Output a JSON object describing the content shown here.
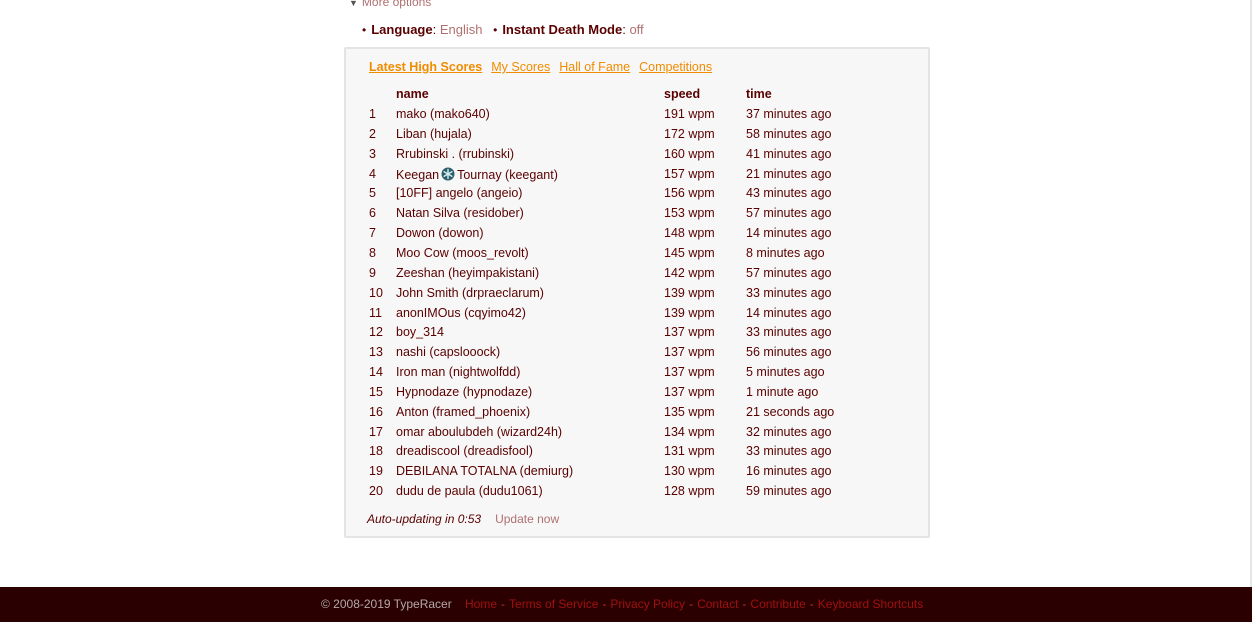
{
  "more_options": {
    "label": "More options"
  },
  "settings": {
    "language_label": "Language",
    "language_value": "English",
    "instant_death_label": "Instant Death Mode",
    "instant_death_value": "off"
  },
  "tabs": [
    {
      "label": "Latest High Scores",
      "active": true
    },
    {
      "label": "My Scores",
      "active": false
    },
    {
      "label": "Hall of Fame",
      "active": false
    },
    {
      "label": "Competitions",
      "active": false
    }
  ],
  "table": {
    "columns": {
      "name": "name",
      "speed": "speed",
      "time": "time"
    },
    "rows": [
      {
        "rank": "1",
        "name": "mako (mako640)",
        "speed": "191 wpm",
        "time": "37 minutes ago"
      },
      {
        "rank": "2",
        "name": "Liban (hujala)",
        "speed": "172 wpm",
        "time": "58 minutes ago"
      },
      {
        "rank": "3",
        "name": "Rrubinski . (rrubinski)",
        "speed": "160 wpm",
        "time": "41 minutes ago"
      },
      {
        "rank": "4",
        "name_before_icon": "Keegan",
        "name_icon": "snowflake-badge-icon",
        "name_after_icon": "Tournay (keegant)",
        "speed": "157 wpm",
        "time": "21 minutes ago"
      },
      {
        "rank": "5",
        "name": "[10FF] angelo (angeio)",
        "speed": "156 wpm",
        "time": "43 minutes ago"
      },
      {
        "rank": "6",
        "name": "Natan Silva (residober)",
        "speed": "153 wpm",
        "time": "57 minutes ago"
      },
      {
        "rank": "7",
        "name": "Dowon (dowon)",
        "speed": "148 wpm",
        "time": "14 minutes ago"
      },
      {
        "rank": "8",
        "name": "Moo Cow (moos_revolt)",
        "speed": "145 wpm",
        "time": "8 minutes ago"
      },
      {
        "rank": "9",
        "name": "Zeeshan (heyimpakistani)",
        "speed": "142 wpm",
        "time": "57 minutes ago"
      },
      {
        "rank": "10",
        "name": "John Smith (drpraeclarum)",
        "speed": "139 wpm",
        "time": "33 minutes ago"
      },
      {
        "rank": "11",
        "name": "anonIMOus (cqyimo42)",
        "speed": "139 wpm",
        "time": "14 minutes ago"
      },
      {
        "rank": "12",
        "name": "boy_314",
        "speed": "137 wpm",
        "time": "33 minutes ago"
      },
      {
        "rank": "13",
        "name": "nashi (capslooock)",
        "speed": "137 wpm",
        "time": "56 minutes ago"
      },
      {
        "rank": "14",
        "name": "Iron man (nightwolfdd)",
        "speed": "137 wpm",
        "time": "5 minutes ago"
      },
      {
        "rank": "15",
        "name": "Hypnodaze (hypnodaze)",
        "speed": "137 wpm",
        "time": "1 minute ago"
      },
      {
        "rank": "16",
        "name": "Anton (framed_phoenix)",
        "speed": "135 wpm",
        "time": "21 seconds ago"
      },
      {
        "rank": "17",
        "name": "omar aboulubdeh (wizard24h)",
        "speed": "134 wpm",
        "time": "32 minutes ago"
      },
      {
        "rank": "18",
        "name": "dreadiscool (dreadisfool)",
        "speed": "131 wpm",
        "time": "33 minutes ago"
      },
      {
        "rank": "19",
        "name": "DEBILANA TOTALNA (demiurg)",
        "speed": "130 wpm",
        "time": "16 minutes ago"
      },
      {
        "rank": "20",
        "name": "dudu de paula (dudu1061)",
        "speed": "128 wpm",
        "time": "59 minutes ago"
      }
    ]
  },
  "auto_update": {
    "text": "Auto-updating in 0:53",
    "update_label": "Update now"
  },
  "footer": {
    "copyright": "© 2008-2019 TypeRacer",
    "links": [
      "Home",
      "Terms of Service",
      "Privacy Policy",
      "Contact",
      "Contribute",
      "Keyboard Shortcuts"
    ]
  },
  "colors": {
    "accent_tab": "#f08c00",
    "text_dark_red": "#5a0000",
    "link_muted": "#b07070",
    "footer_bg": "#2a0000"
  }
}
